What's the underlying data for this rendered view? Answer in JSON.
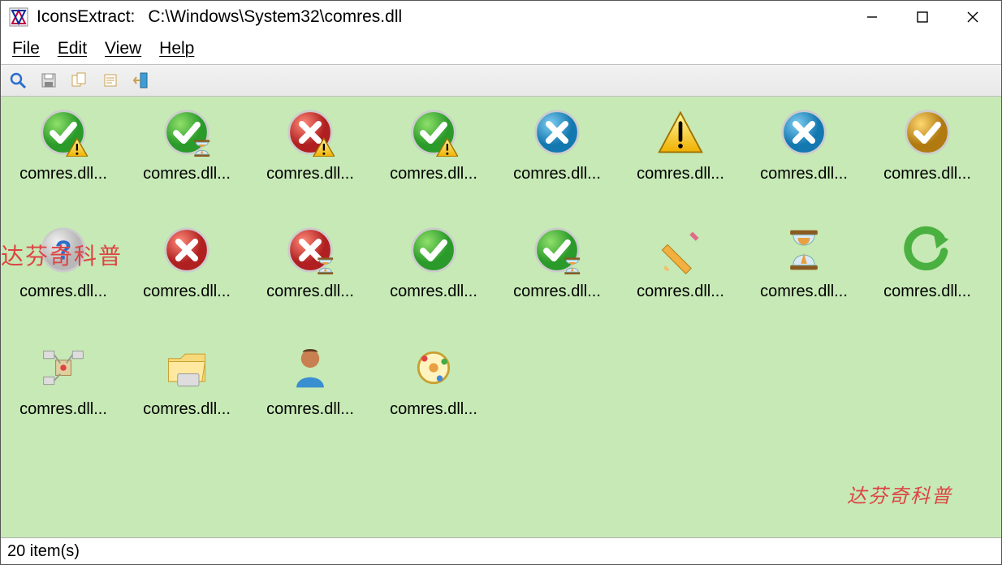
{
  "window": {
    "app_name": "IconsExtract:",
    "file_path": "C:\\Windows\\System32\\comres.dll"
  },
  "menu": {
    "file": "File",
    "edit": "Edit",
    "view": "View",
    "help": "Help"
  },
  "toolbar": {
    "search": "search-icon",
    "save": "save-icon",
    "copy": "copy-icon",
    "properties": "properties-icon",
    "exit": "exit-icon"
  },
  "icons": [
    {
      "label": "comres.dll...",
      "type": "check-green-warn"
    },
    {
      "label": "comres.dll...",
      "type": "check-green-hourglass"
    },
    {
      "label": "comres.dll...",
      "type": "cross-red-warn"
    },
    {
      "label": "comres.dll...",
      "type": "check-green-warn"
    },
    {
      "label": "comres.dll...",
      "type": "cross-blue"
    },
    {
      "label": "comres.dll...",
      "type": "warning-triangle"
    },
    {
      "label": "comres.dll...",
      "type": "cross-blue"
    },
    {
      "label": "comres.dll...",
      "type": "check-gold"
    },
    {
      "label": "comres.dll...",
      "type": "question-blue"
    },
    {
      "label": "comres.dll...",
      "type": "cross-red"
    },
    {
      "label": "comres.dll...",
      "type": "cross-red-hourglass"
    },
    {
      "label": "comres.dll...",
      "type": "check-green"
    },
    {
      "label": "comres.dll...",
      "type": "check-green-hourglass"
    },
    {
      "label": "comres.dll...",
      "type": "pencil"
    },
    {
      "label": "comres.dll...",
      "type": "hourglass"
    },
    {
      "label": "comres.dll...",
      "type": "refresh-arrow"
    },
    {
      "label": "comres.dll...",
      "type": "component"
    },
    {
      "label": "comres.dll...",
      "type": "folder"
    },
    {
      "label": "comres.dll...",
      "type": "user"
    },
    {
      "label": "comres.dll...",
      "type": "atom"
    }
  ],
  "watermarks": {
    "top": "达芬奇科普",
    "bottom": "达芬奇科普"
  },
  "status": {
    "count_text": "20 item(s)"
  }
}
